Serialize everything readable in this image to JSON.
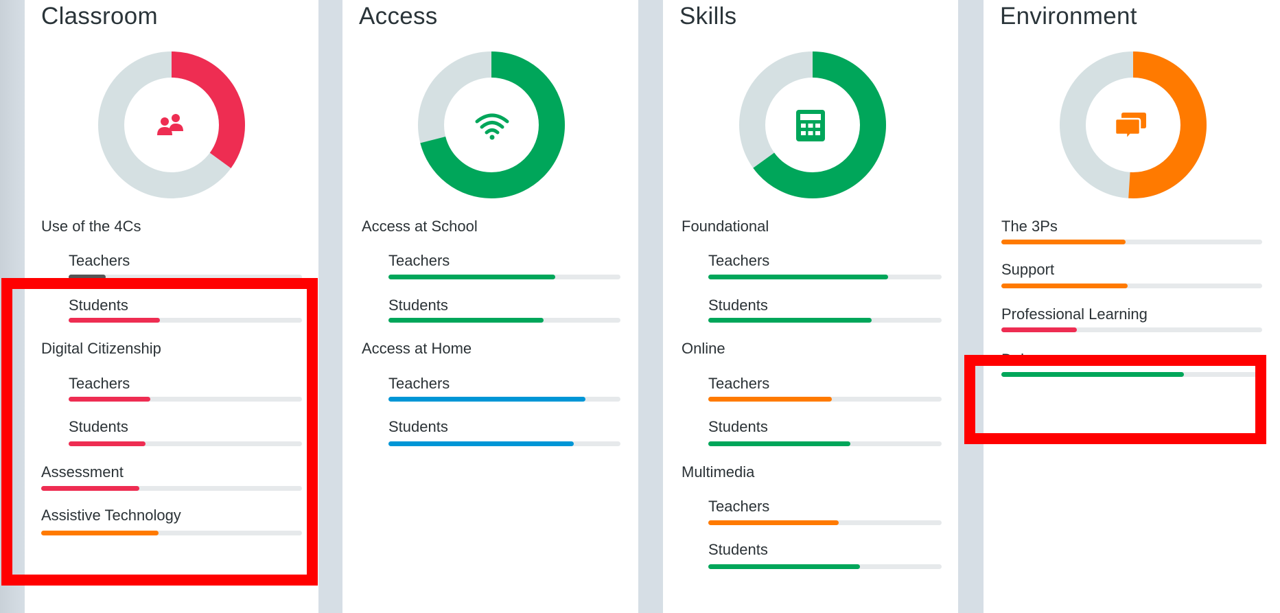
{
  "colors": {
    "red": "#ee2d52",
    "green": "#00a65a",
    "orange": "#ff7a00",
    "blue": "#0096d6",
    "dark": "#555555",
    "track": "#e6e9eb",
    "donut_track": "#d5e0e2"
  },
  "panels": [
    {
      "title": "Classroom",
      "donut": {
        "value": 0.35,
        "color": "red",
        "icon": "people-icon"
      },
      "metrics": [
        {
          "label": "Use of the 4Cs",
          "indent": false
        },
        {
          "label": "Teachers",
          "indent": true,
          "value": 0.16,
          "color": "dark"
        },
        {
          "label": "Students",
          "indent": true,
          "value": 0.39,
          "color": "red"
        },
        {
          "label": "Digital Citizenship",
          "indent": false
        },
        {
          "label": "Teachers",
          "indent": true,
          "value": 0.35,
          "color": "red"
        },
        {
          "label": "Students",
          "indent": true,
          "value": 0.33,
          "color": "red"
        },
        {
          "label": "Assessment",
          "indent": false,
          "value": 0.375,
          "color": "red"
        },
        {
          "label": "Assistive Technology",
          "indent": false,
          "value": 0.45,
          "color": "orange"
        }
      ]
    },
    {
      "title": "Access",
      "donut": {
        "value": 0.71,
        "color": "green",
        "icon": "wifi-icon"
      },
      "metrics": [
        {
          "label": "Access at School",
          "indent": false
        },
        {
          "label": "Teachers",
          "indent": true,
          "value": 0.72,
          "color": "green"
        },
        {
          "label": "Students",
          "indent": true,
          "value": 0.67,
          "color": "green"
        },
        {
          "label": "Access at Home",
          "indent": false
        },
        {
          "label": "Teachers",
          "indent": true,
          "value": 0.85,
          "color": "blue"
        },
        {
          "label": "Students",
          "indent": true,
          "value": 0.8,
          "color": "blue"
        }
      ]
    },
    {
      "title": "Skills",
      "donut": {
        "value": 0.65,
        "color": "green",
        "icon": "calculator-icon"
      },
      "metrics": [
        {
          "label": "Foundational",
          "indent": false
        },
        {
          "label": "Teachers",
          "indent": true,
          "value": 0.77,
          "color": "green"
        },
        {
          "label": "Students",
          "indent": true,
          "value": 0.7,
          "color": "green"
        },
        {
          "label": "Online",
          "indent": false
        },
        {
          "label": "Teachers",
          "indent": true,
          "value": 0.53,
          "color": "orange"
        },
        {
          "label": "Students",
          "indent": true,
          "value": 0.61,
          "color": "green"
        },
        {
          "label": "Multimedia",
          "indent": false
        },
        {
          "label": "Teachers",
          "indent": true,
          "value": 0.56,
          "color": "orange"
        },
        {
          "label": "Students",
          "indent": true,
          "value": 0.65,
          "color": "green"
        }
      ]
    },
    {
      "title": "Environment",
      "donut": {
        "value": 0.51,
        "color": "orange",
        "icon": "chat-icon"
      },
      "metrics": [
        {
          "label": "The 3Ps",
          "indent": false,
          "value": 0.475,
          "color": "orange"
        },
        {
          "label": "Support",
          "indent": false,
          "value": 0.485,
          "color": "orange"
        },
        {
          "label": "Professional Learning",
          "indent": false,
          "value": 0.29,
          "color": "red"
        },
        {
          "label": "Dnl",
          "indent": false,
          "value": 0.7,
          "color": "green",
          "clipped": true
        }
      ]
    }
  ]
}
